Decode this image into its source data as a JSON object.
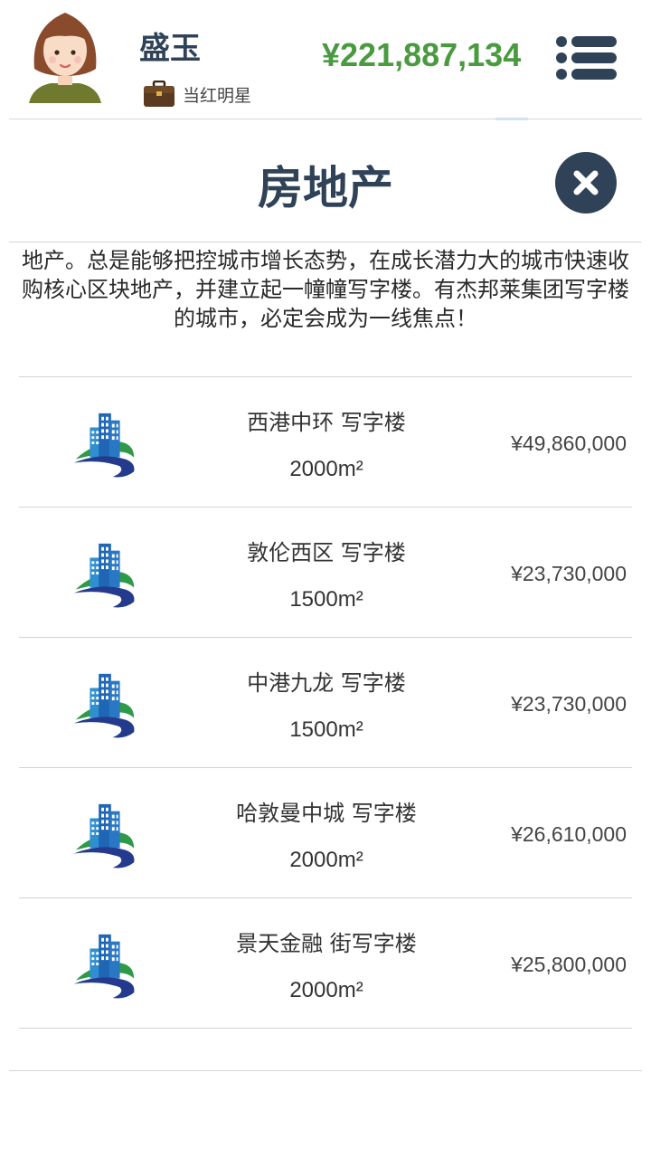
{
  "player": {
    "name": "盛玉",
    "title": "当红明星",
    "money": "¥221,887,134"
  },
  "panel": {
    "title": "房地产",
    "description": "地产。总是能够把控城市增长态势，在成长潜力大的城市快速收购核心区块地产，并建立起一幢幢写字楼。有杰邦莱集团写字楼的城市，必定会成为一线焦点！"
  },
  "properties": [
    {
      "name": "西港中环 写字楼",
      "area": "2000m²",
      "price": "¥49,860,000",
      "icon": "office-building-icon"
    },
    {
      "name": "敦伦西区 写字楼",
      "area": "1500m²",
      "price": "¥23,730,000",
      "icon": "office-building-icon"
    },
    {
      "name": "中港九龙 写字楼",
      "area": "1500m²",
      "price": "¥23,730,000",
      "icon": "office-building-icon"
    },
    {
      "name": "哈敦曼中城 写字楼",
      "area": "2000m²",
      "price": "¥26,610,000",
      "icon": "office-building-icon"
    },
    {
      "name": "景天金融 街写字楼",
      "area": "2000m²",
      "price": "¥25,800,000",
      "icon": "office-building-icon"
    }
  ],
  "colors": {
    "money": "#4a9a3f",
    "primary": "#2f4257"
  }
}
